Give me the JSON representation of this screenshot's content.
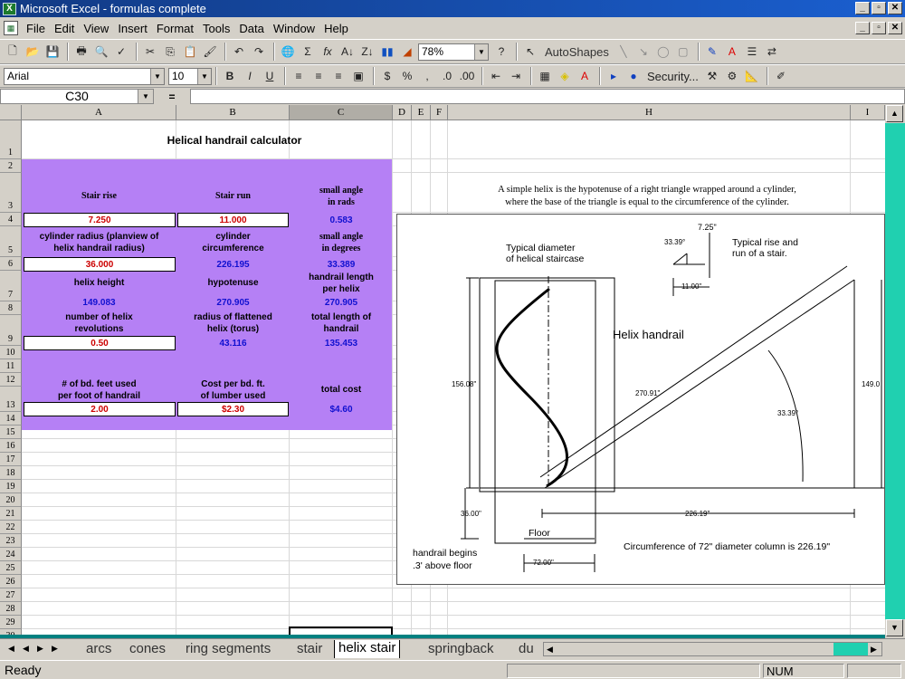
{
  "window": {
    "title": "Microsoft Excel - formulas complete",
    "min": "_",
    "max": "▫",
    "close": "✕"
  },
  "menu": [
    "File",
    "Edit",
    "View",
    "Insert",
    "Format",
    "Tools",
    "Data",
    "Window",
    "Help"
  ],
  "menu_underline": [
    "F",
    "E",
    "V",
    "I",
    "o",
    "T",
    "D",
    "W",
    "H"
  ],
  "toolbar": {
    "zoom": "78%",
    "autoshapes": "AutoShapes",
    "security": "Security..."
  },
  "format": {
    "font": "Arial",
    "size": "10",
    "bold": "B",
    "italic": "I",
    "underline": "U"
  },
  "namebox": "C30",
  "fx": "=",
  "columns": [
    "A",
    "B",
    "C",
    "D",
    "E",
    "F",
    "H",
    "I"
  ],
  "rows": [
    "1",
    "2",
    "3",
    "4",
    "5",
    "6",
    "7",
    "8",
    "9",
    "10",
    "11",
    "12",
    "13",
    "14",
    "15",
    "16",
    "17",
    "18",
    "19",
    "20",
    "21",
    "22",
    "23",
    "24",
    "25",
    "26",
    "27",
    "28",
    "29",
    "30"
  ],
  "sheet": {
    "title": "Helical handrail calculator",
    "stair_rise_label": "Stair rise",
    "stair_run_label": "Stair run",
    "small_angle_rads_label_1": "small angle",
    "small_angle_rads_label_2": "in rads",
    "stair_rise": "7.250",
    "stair_run": "11.000",
    "small_angle_rads": "0.583",
    "cyl_radius_label_1": "cylinder radius (planview of",
    "cyl_radius_label_2": "helix handrail radius)",
    "cyl_circ_label_1": "cylinder",
    "cyl_circ_label_2": "circumference",
    "small_angle_deg_label_1": "small angle",
    "small_angle_deg_label_2": "in degrees",
    "cyl_radius": "36.000",
    "cyl_circ": "226.195",
    "small_angle_deg": "33.389",
    "helix_height_label": "helix height",
    "hypotenuse_label": "hypotenuse",
    "handrail_len_label_1": "handrail length",
    "handrail_len_label_2": "per helix",
    "helix_height": "149.083",
    "hypotenuse": "270.905",
    "handrail_len": "270.905",
    "revs_label_1": "number of helix",
    "revs_label_2": "revolutions",
    "torus_label_1": "radius of  flattened",
    "torus_label_2": "helix (torus)",
    "total_len_label_1": "total length of",
    "total_len_label_2": "handrail",
    "revs": "0.50",
    "torus": "43.116",
    "total_len": "135.453",
    "bdft_label_1": "# of bd. feet used",
    "bdft_label_2": "per foot of handrail",
    "cost_label_1": "Cost per bd. ft.",
    "cost_label_2": "of lumber used",
    "total_cost_label": "total cost",
    "bdft": "2.00",
    "cost": "$2.30",
    "total_cost": "$4.60",
    "desc_1": "A simple helix is the hypotenuse of a right triangle wrapped around a cylinder,",
    "desc_2": "where the base of the triangle is equal to the circumference of the cylinder."
  },
  "diagram": {
    "typ_diam_1": "Typical diameter",
    "typ_diam_2": "of helical staircase",
    "rise_run_1": "Typical rise and",
    "rise_run_2": "run of a stair.",
    "run_dim": "7.25\"",
    "angle_small": "33.39°",
    "run_dim2": "11.00\"",
    "helix_label": "Helix handrail",
    "h_left": "156.08\"",
    "h_right": "149.0",
    "hyp": "270.91\"",
    "angle_big": "33.39°",
    "dim_36": "36.00\"",
    "circ_dim": "226.19\"",
    "floor": "Floor",
    "begins_1": "handrail begins",
    "begins_2": ".3' above floor",
    "dim_72": "72.00\"",
    "circ_note": "Circumference of 72\" diameter column is 226.19\""
  },
  "tabs": [
    "arcs",
    "cones",
    "ring segments",
    "stair",
    "helix stair",
    "springback",
    "du"
  ],
  "active_tab": "helix stair",
  "status": {
    "ready": "Ready",
    "num": "NUM"
  }
}
